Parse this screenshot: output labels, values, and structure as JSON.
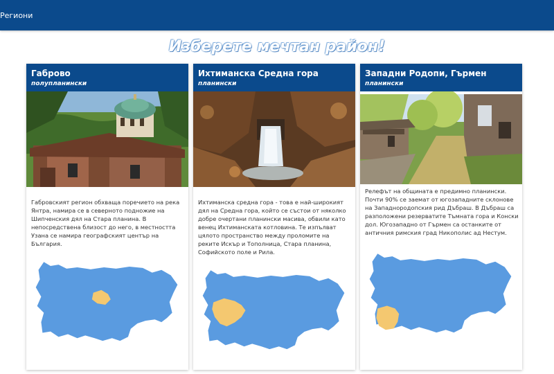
{
  "nav": {
    "title": "Региони"
  },
  "hero": {
    "heading": "Изберете мечтан район!"
  },
  "colors": {
    "primary": "#0b4a8c",
    "map_fill": "#5a9be0",
    "map_highlight": "#f4c870"
  },
  "cards": [
    {
      "title": "Габрово",
      "subtitle": "полупланински",
      "description": "Габровският регион обхваща поречието на река Янтра, намира се в северното подножие на Шипченския дял на Стара планина. В непосредствена близост до него, в местността Узана се намира географският център на България.",
      "photo_icon": "monastery-church-photo",
      "map_icon": "bulgaria-map-gabrovo"
    },
    {
      "title": "Ихтиманска Средна гора",
      "subtitle": "планински",
      "description": "Ихтиманска средна гора - това е най-широкият дял на Средна гора, който се състои от няколко добре очертани планински масива, обвили като венец Ихтиманската котловина. Те изпълват цялото пространство между проломите на реките Искър и Тополница, Стара планина, Софийското поле и Рила.",
      "photo_icon": "waterfall-forest-photo",
      "map_icon": "bulgaria-map-ihtiman"
    },
    {
      "title": "Западни Родопи, Гърмен",
      "subtitle": "планински",
      "description": "Релефът на общината е предимно планински. Почти 90% се заемат от югозападните склонове на Западнородопския рид Дъбраш. В Дъбраш са разположени резерватите Тъмната гора и Конски дол. Югозападно от Гърмен са останките от античния римския град Никополис ад Нестум.",
      "photo_icon": "village-street-photo",
      "map_icon": "bulgaria-map-garmen"
    }
  ]
}
